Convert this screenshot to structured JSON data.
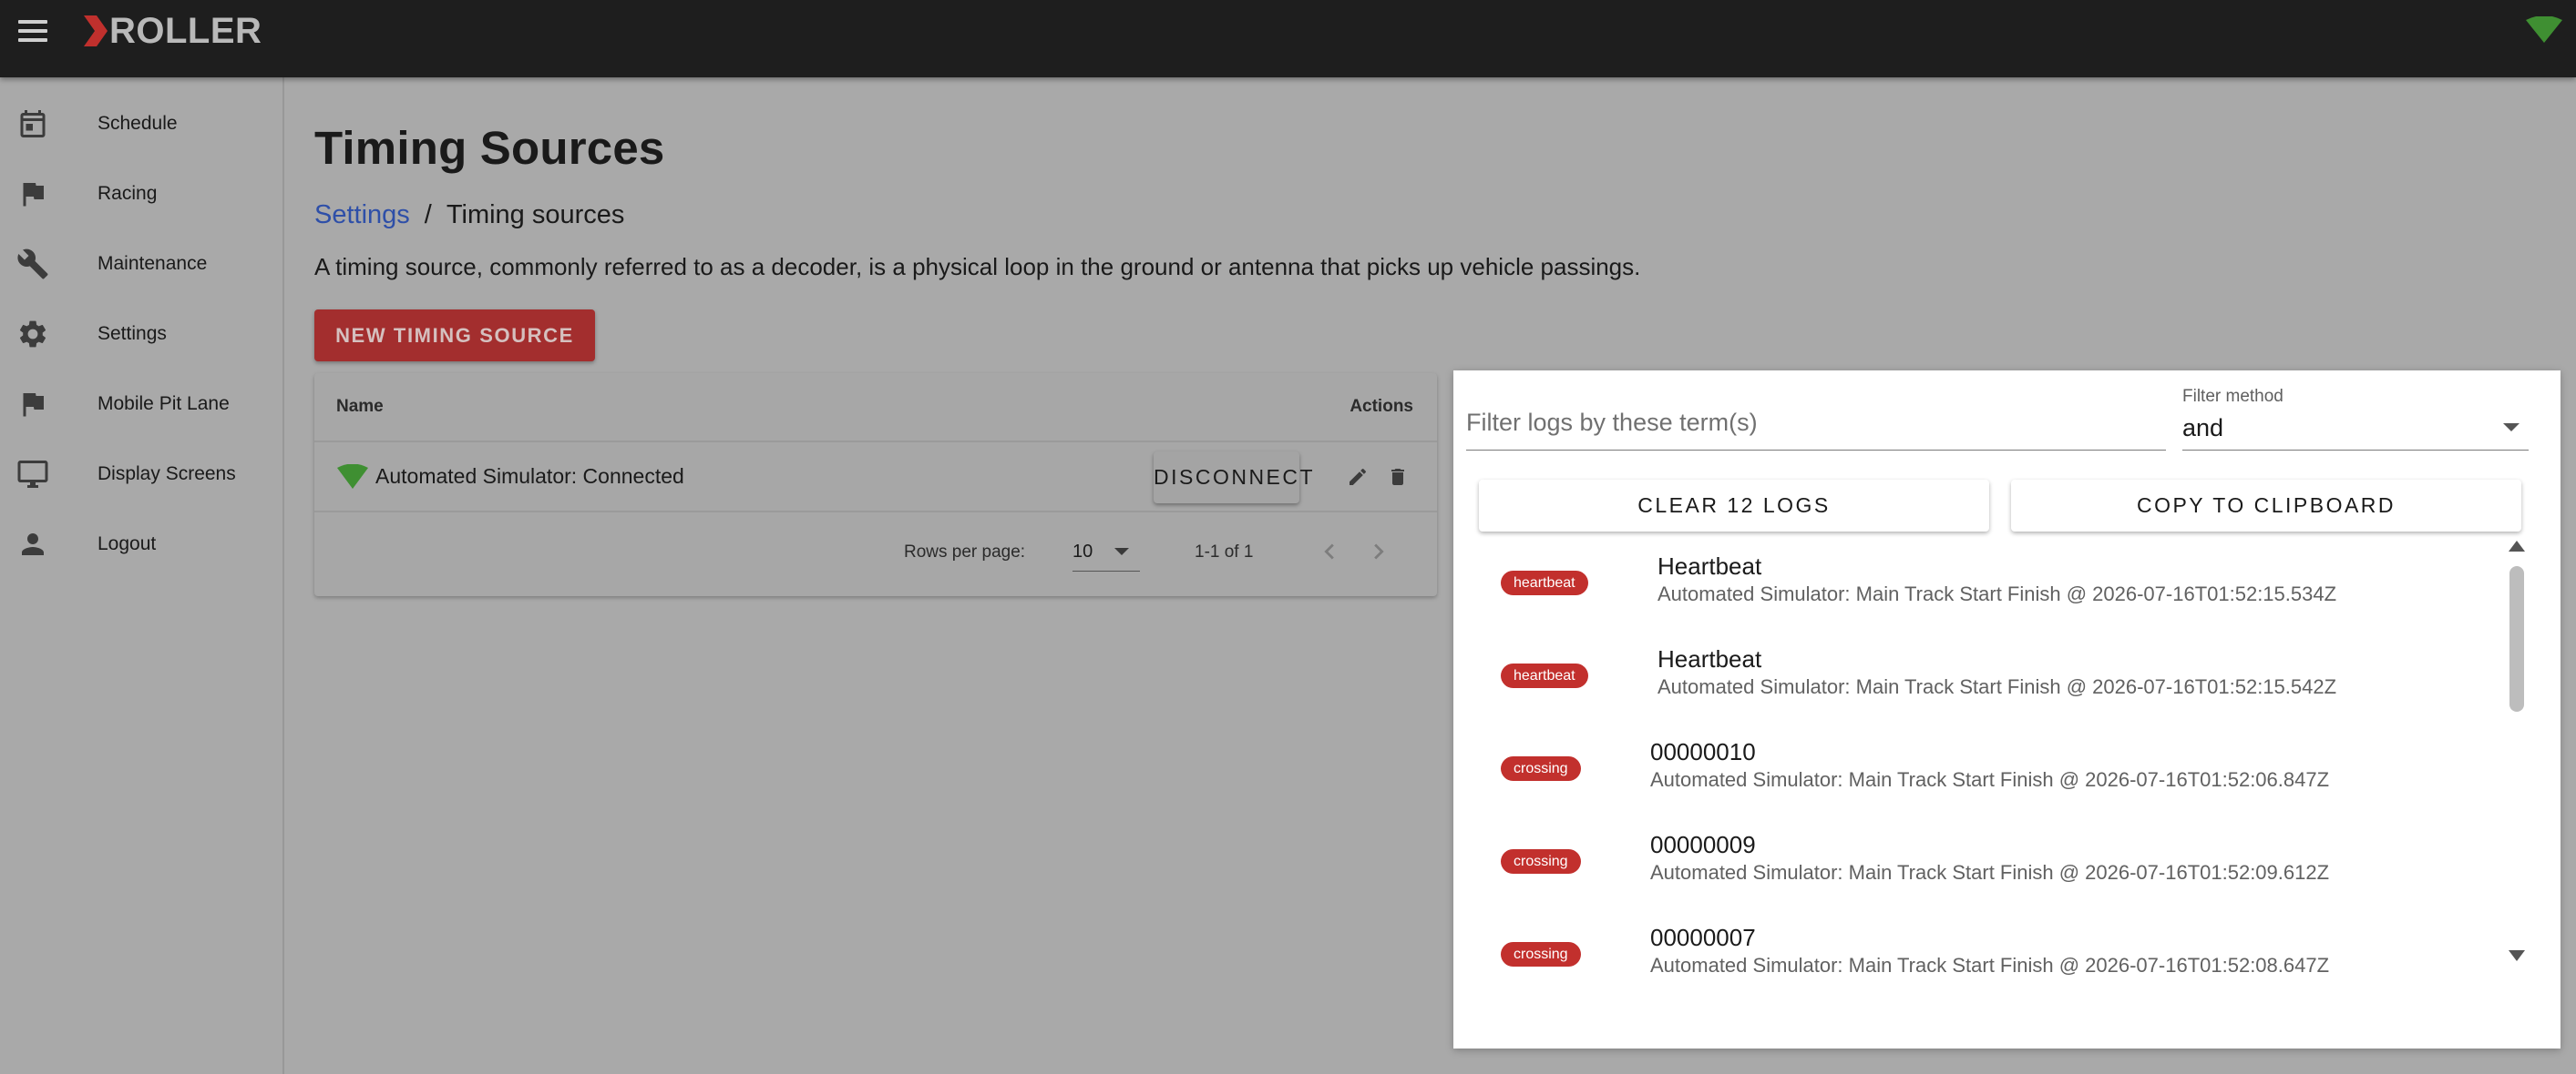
{
  "app": {
    "brand": "ROLLER",
    "accent_color": "#a32e2e",
    "connected_color": "#3f8f32"
  },
  "sidebar": {
    "items": [
      {
        "label": "Schedule",
        "icon": "calendar-icon"
      },
      {
        "label": "Racing",
        "icon": "flag-icon"
      },
      {
        "label": "Maintenance",
        "icon": "wrench-icon"
      },
      {
        "label": "Settings",
        "icon": "gear-icon"
      },
      {
        "label": "Mobile Pit Lane",
        "icon": "flag-icon"
      },
      {
        "label": "Display Screens",
        "icon": "monitor-icon"
      },
      {
        "label": "Logout",
        "icon": "person-icon"
      }
    ]
  },
  "page": {
    "title": "Timing Sources",
    "breadcrumb": {
      "parent": "Settings",
      "separator": "/",
      "current": "Timing sources"
    },
    "description": "A timing source, commonly referred to as a decoder, is a physical loop in the ground or antenna that picks up vehicle passings.",
    "new_button": "NEW TIMING SOURCE"
  },
  "table": {
    "columns": {
      "name": "Name",
      "actions": "Actions"
    },
    "rows": [
      {
        "name": "Automated Simulator: Connected",
        "action_label": "DISCONNECT",
        "status_icon": "wifi-connected-icon"
      }
    ],
    "pagination": {
      "rows_per_page_label": "Rows per page:",
      "rows_per_page": "10",
      "range": "1-1 of 1"
    }
  },
  "logs": {
    "filter_placeholder": "Filter logs by these term(s)",
    "filter_value": "",
    "method_label": "Filter method",
    "method_value": "and",
    "clear_button": "CLEAR 12 LOGS",
    "copy_button": "COPY TO CLIPBOARD",
    "chip_color": "#c2302d",
    "entries": [
      {
        "type": "heartbeat",
        "title": "Heartbeat",
        "detail": "Automated Simulator: Main Track Start Finish @ 2026-07-16T01:52:15.534Z"
      },
      {
        "type": "heartbeat",
        "title": "Heartbeat",
        "detail": "Automated Simulator: Main Track Start Finish @ 2026-07-16T01:52:15.542Z"
      },
      {
        "type": "crossing",
        "title": "00000010",
        "detail": "Automated Simulator: Main Track Start Finish @ 2026-07-16T01:52:06.847Z"
      },
      {
        "type": "crossing",
        "title": "00000009",
        "detail": "Automated Simulator: Main Track Start Finish @ 2026-07-16T01:52:09.612Z"
      },
      {
        "type": "crossing",
        "title": "00000007",
        "detail": "Automated Simulator: Main Track Start Finish @ 2026-07-16T01:52:08.647Z"
      }
    ]
  }
}
